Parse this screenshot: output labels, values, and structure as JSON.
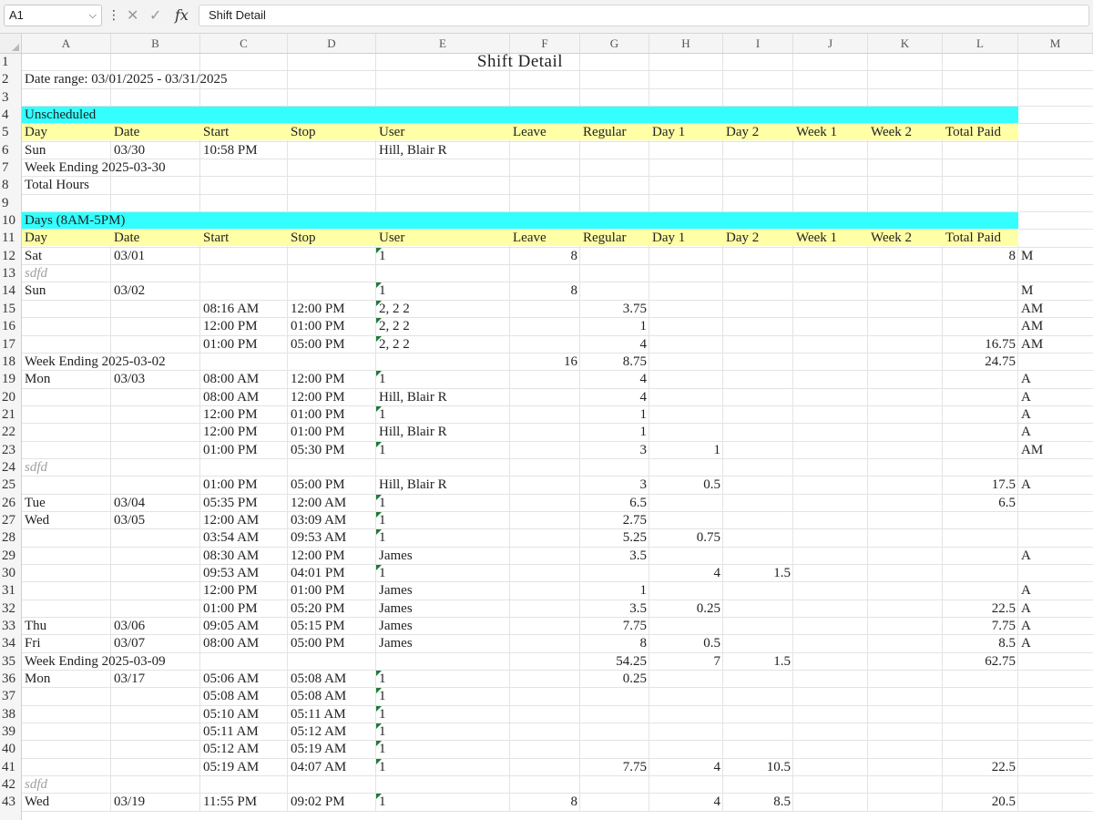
{
  "namebox": {
    "value": "A1"
  },
  "formula": {
    "fx": "fx",
    "value": "Shift Detail"
  },
  "columns": [
    "A",
    "B",
    "C",
    "D",
    "E",
    "F",
    "G",
    "H",
    "I",
    "J",
    "K",
    "L",
    "M"
  ],
  "rows": [
    {
      "n": "1",
      "title": "Shift Detail"
    },
    {
      "n": "2",
      "text": "Date range: 03/01/2025 - 03/31/2025"
    },
    {
      "n": "3"
    },
    {
      "n": "4",
      "band": "cyan",
      "text": "Unscheduled"
    },
    {
      "n": "5",
      "band": "yellow",
      "hdr": true
    },
    {
      "n": "6",
      "c": {
        "A": "Sun",
        "B": "03/30",
        "C": "10:58 PM",
        "E": "Hill, Blair R"
      }
    },
    {
      "n": "7",
      "text": "Week Ending 2025-03-30"
    },
    {
      "n": "8",
      "text": "Total Hours"
    },
    {
      "n": "9"
    },
    {
      "n": "10",
      "band": "cyan",
      "text": "Days (8AM-5PM)"
    },
    {
      "n": "11",
      "band": "yellow",
      "hdr": true
    },
    {
      "n": "12",
      "c": {
        "A": "Sat",
        "B": "03/01",
        "E": "1",
        "F": "8",
        "L": "8",
        "M": "M"
      },
      "tri": true
    },
    {
      "n": "13",
      "gray": "sdfd"
    },
    {
      "n": "14",
      "c": {
        "A": "Sun",
        "B": "03/02",
        "E": "1",
        "F": "8",
        "M": "M"
      },
      "tri": true
    },
    {
      "n": "15",
      "c": {
        "C": "08:16 AM",
        "D": "12:00 PM",
        "E": "2, 2 2",
        "G": "3.75",
        "M": "AM"
      },
      "tri": true
    },
    {
      "n": "16",
      "c": {
        "C": "12:00 PM",
        "D": "01:00 PM",
        "E": "2, 2 2",
        "G": "1",
        "M": "AM"
      },
      "tri": true
    },
    {
      "n": "17",
      "c": {
        "C": "01:00 PM",
        "D": "05:00 PM",
        "E": "2, 2 2",
        "G": "4",
        "L": "16.75",
        "M": "AM"
      },
      "tri": true
    },
    {
      "n": "18",
      "text": "Week Ending 2025-03-02",
      "c": {
        "F": "16",
        "G": "8.75",
        "L": "24.75"
      }
    },
    {
      "n": "19",
      "c": {
        "A": "Mon",
        "B": "03/03",
        "C": "08:00 AM",
        "D": "12:00 PM",
        "E": "1",
        "G": "4",
        "M": "A"
      },
      "tri": true
    },
    {
      "n": "20",
      "c": {
        "C": "08:00 AM",
        "D": "12:00 PM",
        "E": "Hill, Blair R",
        "G": "4",
        "M": "A"
      }
    },
    {
      "n": "21",
      "c": {
        "C": "12:00 PM",
        "D": "01:00 PM",
        "E": "1",
        "G": "1",
        "M": "A"
      },
      "tri": true
    },
    {
      "n": "22",
      "c": {
        "C": "12:00 PM",
        "D": "01:00 PM",
        "E": "Hill, Blair R",
        "G": "1",
        "M": "A"
      }
    },
    {
      "n": "23",
      "c": {
        "C": "01:00 PM",
        "D": "05:30 PM",
        "E": "1",
        "G": "3",
        "H": "1",
        "M": "AM"
      },
      "tri": true
    },
    {
      "n": "24",
      "gray": "sdfd"
    },
    {
      "n": "25",
      "c": {
        "C": "01:00 PM",
        "D": "05:00 PM",
        "E": "Hill, Blair R",
        "G": "3",
        "H": "0.5",
        "L": "17.5",
        "M": "A"
      }
    },
    {
      "n": "26",
      "c": {
        "A": "Tue",
        "B": "03/04",
        "C": "05:35 PM",
        "D": "12:00 AM",
        "E": "1",
        "G": "6.5",
        "L": "6.5"
      },
      "tri": true
    },
    {
      "n": "27",
      "c": {
        "A": "Wed",
        "B": "03/05",
        "C": "12:00 AM",
        "D": "03:09 AM",
        "E": "1",
        "G": "2.75"
      },
      "tri": true
    },
    {
      "n": "28",
      "c": {
        "C": "03:54 AM",
        "D": "09:53 AM",
        "E": "1",
        "G": "5.25",
        "H": "0.75"
      },
      "tri": true
    },
    {
      "n": "29",
      "c": {
        "C": "08:30 AM",
        "D": "12:00 PM",
        "E": "James",
        "G": "3.5",
        "M": "A"
      }
    },
    {
      "n": "30",
      "c": {
        "C": "09:53 AM",
        "D": "04:01 PM",
        "E": "1",
        "H": "4",
        "I": "1.5"
      },
      "tri": true
    },
    {
      "n": "31",
      "c": {
        "C": "12:00 PM",
        "D": "01:00 PM",
        "E": "James",
        "G": "1",
        "M": "A"
      }
    },
    {
      "n": "32",
      "c": {
        "C": "01:00 PM",
        "D": "05:20 PM",
        "E": "James",
        "G": "3.5",
        "H": "0.25",
        "L": "22.5",
        "M": "A"
      }
    },
    {
      "n": "33",
      "c": {
        "A": "Thu",
        "B": "03/06",
        "C": "09:05 AM",
        "D": "05:15 PM",
        "E": "James",
        "G": "7.75",
        "L": "7.75",
        "M": "A"
      }
    },
    {
      "n": "34",
      "c": {
        "A": "Fri",
        "B": "03/07",
        "C": "08:00 AM",
        "D": "05:00 PM",
        "E": "James",
        "G": "8",
        "H": "0.5",
        "L": "8.5",
        "M": "A"
      }
    },
    {
      "n": "35",
      "text": "Week Ending 2025-03-09",
      "c": {
        "G": "54.25",
        "H": "7",
        "I": "1.5",
        "L": "62.75"
      }
    },
    {
      "n": "36",
      "c": {
        "A": "Mon",
        "B": "03/17",
        "C": "05:06 AM",
        "D": "05:08 AM",
        "E": "1",
        "G": "0.25"
      },
      "tri": true
    },
    {
      "n": "37",
      "c": {
        "C": "05:08 AM",
        "D": "05:08 AM",
        "E": "1"
      },
      "tri": true
    },
    {
      "n": "38",
      "c": {
        "C": "05:10 AM",
        "D": "05:11 AM",
        "E": "1"
      },
      "tri": true
    },
    {
      "n": "39",
      "c": {
        "C": "05:11 AM",
        "D": "05:12 AM",
        "E": "1"
      },
      "tri": true
    },
    {
      "n": "40",
      "c": {
        "C": "05:12 AM",
        "D": "05:19 AM",
        "E": "1"
      },
      "tri": true
    },
    {
      "n": "41",
      "c": {
        "C": "05:19 AM",
        "D": "04:07 AM",
        "E": "1",
        "G": "7.75",
        "H": "4",
        "I": "10.5",
        "L": "22.5"
      },
      "tri": true
    },
    {
      "n": "42",
      "gray": "sdfd"
    },
    {
      "n": "43",
      "c": {
        "A": "Wed",
        "B": "03/19",
        "C": "11:55 PM",
        "D": "09:02 PM",
        "E": "1",
        "F": "8",
        "H": "4",
        "I": "8.5",
        "L": "20.5"
      },
      "tri": true
    }
  ],
  "header_labels": {
    "A": "Day",
    "B": "Date",
    "C": "Start",
    "D": "Stop",
    "E": "User",
    "F": "Leave",
    "G": "Regular",
    "H": "Day 1",
    "I": "Day 2",
    "J": "Week 1",
    "K": "Week 2",
    "L": "Total Paid"
  }
}
